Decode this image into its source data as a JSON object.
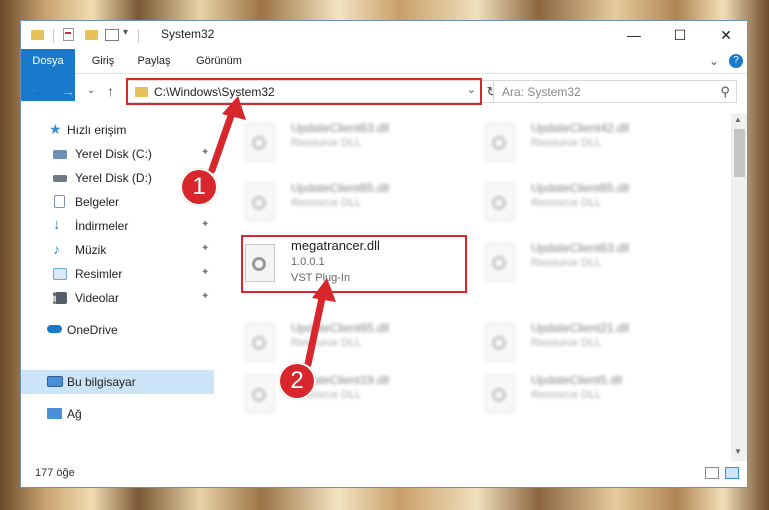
{
  "window": {
    "title": "System32",
    "controls": {
      "minimize": "—",
      "maximize": "☐",
      "close": "✕"
    }
  },
  "ribbon": {
    "tabs": [
      "Dosya",
      "Giriş",
      "Paylaş",
      "Görünüm"
    ],
    "collapse": "⌄",
    "help": "?"
  },
  "nav": {
    "back": "←",
    "forward": "→",
    "recent": "⌄",
    "up": "↑",
    "address": "C:\\Windows\\System32",
    "address_dropdown": "⌄",
    "refresh": "↻",
    "search_placeholder": "Ara: System32",
    "search_icon": "⚲"
  },
  "sidebar": {
    "items": [
      {
        "label": "Hızlı erişim",
        "icon": "star-icon",
        "color": "#3b8fd6"
      },
      {
        "label": "Yerel Disk (C:)",
        "icon": "drive-icon",
        "color": "#6f8fb5",
        "pinned": true
      },
      {
        "label": "Yerel Disk (D:)",
        "icon": "drive-icon",
        "color": "#6f7a86",
        "pinned": true
      },
      {
        "label": "Belgeler",
        "icon": "documents-icon",
        "color": "#8fa6c2",
        "pinned": true
      },
      {
        "label": "İndirmeler",
        "icon": "download-icon",
        "color": "#2e7fd0",
        "pinned": true
      },
      {
        "label": "Müzik",
        "icon": "music-icon",
        "color": "#3b8fd6",
        "pinned": true
      },
      {
        "label": "Resimler",
        "icon": "pictures-icon",
        "color": "#6fa8d6",
        "pinned": true
      },
      {
        "label": "Videolar",
        "icon": "videos-icon",
        "color": "#555e69",
        "pinned": true
      },
      {
        "label": "OneDrive",
        "icon": "cloud-icon",
        "color": "#1979ca"
      },
      {
        "label": "Bu bilgisayar",
        "icon": "computer-icon",
        "color": "#4a90d9",
        "selected": true
      },
      {
        "label": "Ağ",
        "icon": "network-icon",
        "color": "#4a90d9"
      }
    ],
    "pin_glyph": "📌"
  },
  "files": {
    "left_column": [
      {
        "name": "UpdateClient63.dll",
        "sub1": "Resource DLL",
        "sub2": "",
        "blurred": true
      },
      {
        "name": "UpdateClient65.dll",
        "sub1": "Resource DLL",
        "sub2": "",
        "blurred": true
      },
      {
        "name": "megatrancer.dll",
        "sub1": "1.0.0.1",
        "sub2": "VST Plug-In",
        "blurred": false
      },
      {
        "name": "UpdateClient65.dll",
        "sub1": "Resource DLL",
        "sub2": "",
        "blurred": true
      },
      {
        "name": "UpdateClient19.dll",
        "sub1": "Resource DLL",
        "sub2": "",
        "blurred": true
      }
    ],
    "right_column": [
      {
        "name": "UpdateClient42.dll",
        "sub1": "Resource DLL",
        "blurred": true
      },
      {
        "name": "UpdateClient65.dll",
        "sub1": "Resource DLL",
        "blurred": true
      },
      {
        "name": "UpdateClient63.dll",
        "sub1": "Resource DLL",
        "blurred": true
      },
      {
        "name": "UpdateClient21.dll",
        "sub1": "Resource DLL",
        "blurred": true
      },
      {
        "name": "UpdateClient5.dll",
        "sub1": "Resource DLL",
        "blurred": true
      }
    ]
  },
  "status": {
    "count": "177 öğe"
  },
  "annotations": {
    "marker1": "1",
    "marker2": "2",
    "color": "#d8262d"
  },
  "scroll": {
    "up": "▲",
    "down": "▼"
  }
}
